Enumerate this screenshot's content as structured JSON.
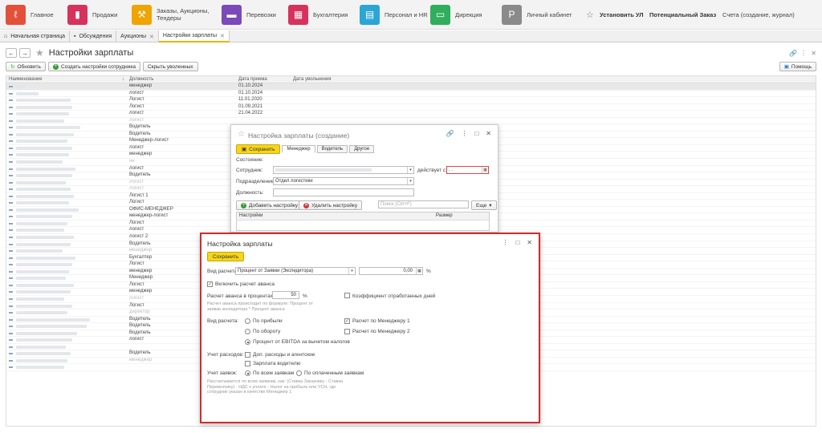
{
  "top_sections": [
    {
      "label": "Главное",
      "color": "#e3513b",
      "icon": "logo-icon"
    },
    {
      "label": "Продажи",
      "color": "#d6325c",
      "icon": "sales-chart-icon"
    },
    {
      "label": "Заказы, Аукционы,\nТендеры",
      "color": "#f0a400",
      "icon": "gavel-icon"
    },
    {
      "label": "Перевозки",
      "color": "#7a4ab8",
      "icon": "truck-icon"
    },
    {
      "label": "Бухгалтерия",
      "color": "#d6325c",
      "icon": "calculator-icon"
    },
    {
      "label": "Персонал и HR",
      "color": "#2aa6d6",
      "icon": "id-card-icon"
    },
    {
      "label": "Дирекция",
      "color": "#2fae5e",
      "icon": "briefcase-icon"
    },
    {
      "label": "Личный кабинет",
      "color": "#8a8a8a",
      "icon": "parking-icon"
    }
  ],
  "topright": {
    "install": "Установить УЛ",
    "potential": "Потенциальный Заказ",
    "invoices": "Счета (создание, журнал)"
  },
  "tabs": [
    {
      "label": "Начальная страница"
    },
    {
      "label": "Обсуждения"
    },
    {
      "label": "Аукционы"
    },
    {
      "label": "Настройки зарплаты"
    }
  ],
  "page": {
    "title": "Настройки зарплаты",
    "refresh": "Обновить",
    "create": "Создать настройки сотрудника",
    "hide": "Скрыть уволенных",
    "help": "Помощь"
  },
  "table": {
    "headers": [
      "Наименование",
      "Должность",
      "Дата приема",
      "Дата увольнения"
    ],
    "rows": [
      {
        "nw": 12,
        "pos": "менеджер",
        "date": "01.10.2024"
      },
      {
        "nw": 28,
        "pos": "логист",
        "date": "01.10.2024"
      },
      {
        "nw": 68,
        "pos": "Логист",
        "date": "11.01.2020"
      },
      {
        "nw": 70,
        "pos": "Логист",
        "date": "01.09.2021"
      },
      {
        "nw": 66,
        "pos": "логист",
        "date": "21.04.2022"
      },
      {
        "nw": 60,
        "pos": "логист",
        "date": "",
        "g": true
      },
      {
        "nw": 80,
        "pos": "Водитель",
        "date": ""
      },
      {
        "nw": 72,
        "pos": "Водитель",
        "date": ""
      },
      {
        "nw": 64,
        "pos": "Менеджер-логист",
        "date": ""
      },
      {
        "nw": 70,
        "pos": "логист",
        "date": ""
      },
      {
        "nw": 66,
        "pos": "менеджер",
        "date": ""
      },
      {
        "nw": 58,
        "pos": "нн",
        "date": "",
        "g": true
      },
      {
        "nw": 74,
        "pos": "логист",
        "date": ""
      },
      {
        "nw": 70,
        "pos": "Водитель",
        "date": ""
      },
      {
        "nw": 62,
        "pos": "логист",
        "date": "",
        "g": true
      },
      {
        "nw": 68,
        "pos": "логист",
        "date": "",
        "g": true
      },
      {
        "nw": 72,
        "pos": "Логист 1",
        "date": ""
      },
      {
        "nw": 66,
        "pos": "Логист",
        "date": ""
      },
      {
        "nw": 78,
        "pos": "ОФИС-МЕНЕДЖЕР",
        "date": ""
      },
      {
        "nw": 70,
        "pos": "менеджер-логист",
        "date": ""
      },
      {
        "nw": 64,
        "pos": "Логист",
        "date": ""
      },
      {
        "nw": 60,
        "pos": "логист",
        "date": ""
      },
      {
        "nw": 72,
        "pos": " логист 2",
        "date": ""
      },
      {
        "nw": 68,
        "pos": "Водитель",
        "date": ""
      },
      {
        "nw": 58,
        "pos": "менеджер",
        "date": "",
        "g": true
      },
      {
        "nw": 74,
        "pos": "Бухгалтер",
        "date": ""
      },
      {
        "nw": 70,
        "pos": "Логист",
        "date": ""
      },
      {
        "nw": 66,
        "pos": "менеджер",
        "date": ""
      },
      {
        "nw": 62,
        "pos": "Менеджер",
        "date": ""
      },
      {
        "nw": 72,
        "pos": "Логист",
        "date": ""
      },
      {
        "nw": 68,
        "pos": "менеджер",
        "date": ""
      },
      {
        "nw": 60,
        "pos": "логист",
        "date": "",
        "g": true
      },
      {
        "nw": 70,
        "pos": "Логист",
        "date": ""
      },
      {
        "nw": 64,
        "pos": "директор",
        "date": "",
        "g": true
      },
      {
        "nw": 92,
        "pos": "Водитель",
        "date": ""
      },
      {
        "nw": 88,
        "pos": "Водитель",
        "date": ""
      },
      {
        "nw": 76,
        "pos": "Водитель",
        "date": ""
      },
      {
        "nw": 70,
        "pos": "логист",
        "date": ""
      },
      {
        "nw": 62,
        "pos": "",
        "date": ""
      },
      {
        "nw": 68,
        "pos": "Водитель",
        "date": ""
      },
      {
        "nw": 64,
        "pos": "менеджер",
        "date": "",
        "g": true
      },
      {
        "nw": 60,
        "pos": "",
        "date": ""
      }
    ]
  },
  "dialog1": {
    "title": "Настройка зарплаты (создание)",
    "save": "Сохранить",
    "tabs": [
      "Менеджер",
      "Водитель",
      "Другое"
    ],
    "state_label": "Состояние:",
    "employee_label": "Сотрудник:",
    "valid_from": "действует с:",
    "date_value": ". .",
    "dept_label": "Подразделение:",
    "dept_value": "Отдел логистики",
    "position_label": "Должность:",
    "add_setting": "Добавить настройку",
    "del_setting": "Удалить настройку",
    "search_placeholder": "Поиск (Ctrl+F)",
    "more": "Еще",
    "col_settings": "Настройки",
    "col_size": "Размер"
  },
  "dialog2": {
    "title": "Настройка зарплаты",
    "save": "Сохранить",
    "calc_type_label": "Вид расчета:",
    "calc_type_value": "Процент от Заявки (Экспедитора)",
    "amount": "0,00",
    "pct": "%",
    "include_advance": "Включить расчет аванса",
    "advance_pct_label": "Расчет аванса в процентах:",
    "advance_pct_value": "50",
    "worked_days": "Коэффициент отработанных дней",
    "advance_note": "Расчет аванса происходит по формуле: Процент от заявки экспедитора * Процент аванса",
    "calc_kind_label": "Вид расчета:",
    "by_profit": "По прибыли",
    "by_turnover": "По обороту",
    "ebitda": "Процент от EBITDA за вычетом налогов",
    "mgr1": "Расчет по Менеджеру 1",
    "mgr2": "Расчет по Менеджеру 2",
    "expenses_label": "Учет расходов:",
    "extra_exp": "Доп. расходы и агентские",
    "driver_salary": "Зарплата водителю",
    "orders_label": "Учет заявок:",
    "all_orders": "По всем заявкам",
    "paid_orders": "По оплаченным заявкам",
    "formula_note": "Рассчитывается по всем заявкам, как: (Ставка Заказчику - Ставка Перевозчику) - НДС к уплате - Налог на прибыль или УСН, где сотрудник указан в качестве Менеджер 1"
  }
}
